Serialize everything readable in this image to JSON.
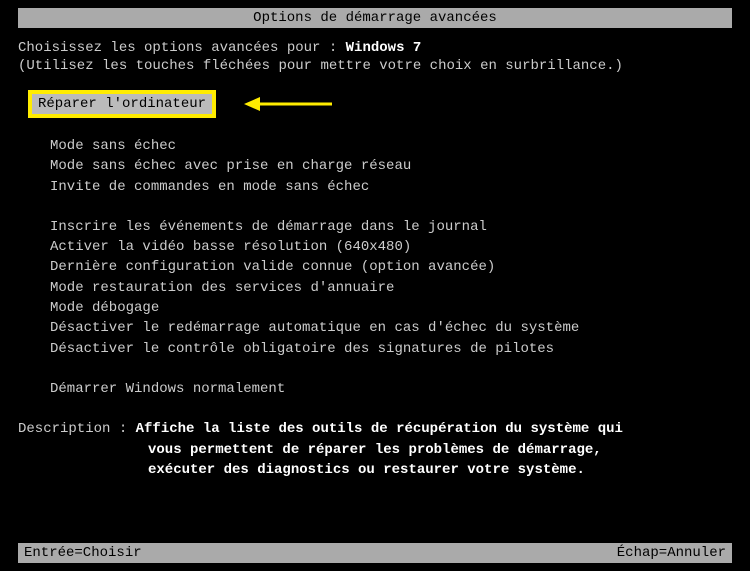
{
  "title": "Options de démarrage avancées",
  "intro": {
    "prefix": "Choisissez les options avancées pour : ",
    "os": "Windows 7"
  },
  "hint": "(Utilisez les touches fléchées pour mettre votre choix en surbrillance.)",
  "selected": "Réparer l'ordinateur",
  "group1": [
    "Mode sans échec",
    "Mode sans échec avec prise en charge réseau",
    "Invite de commandes en mode sans échec"
  ],
  "group2": [
    "Inscrire les événements de démarrage dans le journal",
    "Activer la vidéo basse résolution (640x480)",
    "Dernière configuration valide connue (option avancée)",
    "Mode restauration des services d'annuaire",
    "Mode débogage",
    "Désactiver le redémarrage automatique en cas d'échec du système",
    "Désactiver le contrôle obligatoire des signatures de pilotes"
  ],
  "group3": [
    "Démarrer Windows normalement"
  ],
  "description": {
    "label": "Description : ",
    "line1": "Affiche la liste des outils de récupération du système qui",
    "line2": "vous permettent de réparer les problèmes de démarrage,",
    "line3": "exécuter des diagnostics ou restaurer votre système."
  },
  "footer": {
    "left": "Entrée=Choisir",
    "right": "Échap=Annuler"
  }
}
